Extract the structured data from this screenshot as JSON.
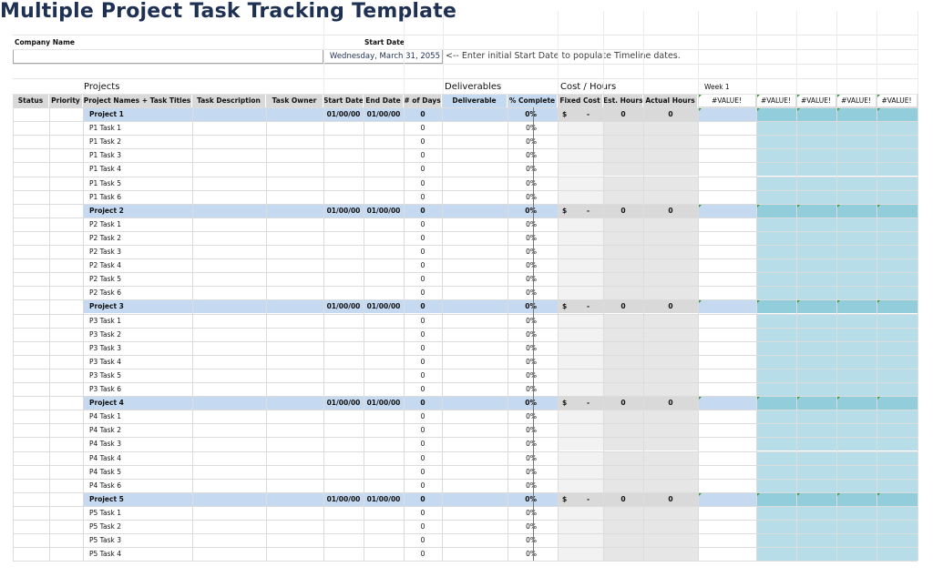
{
  "title": "Multiple Project Task Tracking Template",
  "company_name_label": "Company Name",
  "start_date_label": "Start Date",
  "start_date_value": "Wednesday, March 31, 2055",
  "start_date_hint": "<-- Enter initial Start Date to populate Timeline dates.",
  "sections": {
    "projects": "Projects",
    "deliverables": "Deliverables",
    "cost_hours": "Cost / Hours",
    "week": "Week 1"
  },
  "columns": {
    "status": "Status",
    "priority": "Priority",
    "names": "Project Names + Task Titles",
    "description": "Task Description",
    "owner": "Task Owner",
    "start": "Start Date",
    "end": "End Date",
    "days": "# of Days",
    "deliverable": "Deliverable",
    "complete": "% Complete",
    "fixed_cost": "Fixed Cost",
    "est_hours": "Est. Hours",
    "actual_hours": "Actual Hours",
    "timeline": [
      "#VALUE!",
      "#VALUE!",
      "#VALUE!",
      "#VALUE!",
      "#VALUE!"
    ]
  },
  "rows": [
    {
      "type": "project",
      "name": "Project 1",
      "start": "01/00/00",
      "end": "01/00/00",
      "days": "0",
      "complete": "0%",
      "cost": "$",
      "cost_val": "-",
      "est": "0",
      "actual": "0"
    },
    {
      "type": "task",
      "name": "P1 Task 1",
      "days": "0",
      "complete": "0%"
    },
    {
      "type": "task",
      "name": "P1 Task 2",
      "days": "0",
      "complete": "0%"
    },
    {
      "type": "task",
      "name": "P1 Task 3",
      "days": "0",
      "complete": "0%"
    },
    {
      "type": "task",
      "name": "P1 Task 4",
      "days": "0",
      "complete": "0%"
    },
    {
      "type": "task",
      "name": "P1 Task 5",
      "days": "0",
      "complete": "0%"
    },
    {
      "type": "task",
      "name": "P1 Task 6",
      "days": "0",
      "complete": "0%"
    },
    {
      "type": "project",
      "name": "Project 2",
      "start": "01/00/00",
      "end": "01/00/00",
      "days": "0",
      "complete": "0%",
      "cost": "$",
      "cost_val": "-",
      "est": "0",
      "actual": "0"
    },
    {
      "type": "task",
      "name": "P2 Task 1",
      "days": "0",
      "complete": "0%"
    },
    {
      "type": "task",
      "name": "P2 Task 2",
      "days": "0",
      "complete": "0%"
    },
    {
      "type": "task",
      "name": "P2 Task 3",
      "days": "0",
      "complete": "0%"
    },
    {
      "type": "task",
      "name": "P2 Task 4",
      "days": "0",
      "complete": "0%"
    },
    {
      "type": "task",
      "name": "P2 Task 5",
      "days": "0",
      "complete": "0%"
    },
    {
      "type": "task",
      "name": "P2 Task 6",
      "days": "0",
      "complete": "0%"
    },
    {
      "type": "project",
      "name": "Project 3",
      "start": "01/00/00",
      "end": "01/00/00",
      "days": "0",
      "complete": "0%",
      "cost": "$",
      "cost_val": "-",
      "est": "0",
      "actual": "0"
    },
    {
      "type": "task",
      "name": "P3 Task 1",
      "days": "0",
      "complete": "0%"
    },
    {
      "type": "task",
      "name": "P3 Task 2",
      "days": "0",
      "complete": "0%"
    },
    {
      "type": "task",
      "name": "P3 Task 3",
      "days": "0",
      "complete": "0%"
    },
    {
      "type": "task",
      "name": "P3 Task 4",
      "days": "0",
      "complete": "0%"
    },
    {
      "type": "task",
      "name": "P3 Task 5",
      "days": "0",
      "complete": "0%"
    },
    {
      "type": "task",
      "name": "P3 Task 6",
      "days": "0",
      "complete": "0%"
    },
    {
      "type": "project",
      "name": "Project 4",
      "start": "01/00/00",
      "end": "01/00/00",
      "days": "0",
      "complete": "0%",
      "cost": "$",
      "cost_val": "-",
      "est": "0",
      "actual": "0"
    },
    {
      "type": "task",
      "name": "P4 Task 1",
      "days": "0",
      "complete": "0%"
    },
    {
      "type": "task",
      "name": "P4 Task 2",
      "days": "0",
      "complete": "0%"
    },
    {
      "type": "task",
      "name": "P4 Task 3",
      "days": "0",
      "complete": "0%"
    },
    {
      "type": "task",
      "name": "P4 Task 4",
      "days": "0",
      "complete": "0%"
    },
    {
      "type": "task",
      "name": "P4 Task 5",
      "days": "0",
      "complete": "0%"
    },
    {
      "type": "task",
      "name": "P4 Task 6",
      "days": "0",
      "complete": "0%"
    },
    {
      "type": "project",
      "name": "Project 5",
      "start": "01/00/00",
      "end": "01/00/00",
      "days": "0",
      "complete": "0%",
      "cost": "$",
      "cost_val": "-",
      "est": "0",
      "actual": "0"
    },
    {
      "type": "task",
      "name": "P5 Task 1",
      "days": "0",
      "complete": "0%"
    },
    {
      "type": "task",
      "name": "P5 Task 2",
      "days": "0",
      "complete": "0%"
    },
    {
      "type": "task",
      "name": "P5 Task 3",
      "days": "0",
      "complete": "0%"
    },
    {
      "type": "task",
      "name": "P5 Task 4",
      "days": "0",
      "complete": "0%"
    }
  ],
  "colors": {
    "title": "#1f3153",
    "header_fill": "#d9d9d9",
    "project_fill": "#c5d9f1",
    "timeline_fill": "#b7dde8",
    "timeline_project_fill": "#92cddc",
    "cost_fill": "#f2f2f2",
    "hours_fill": "#e6e6e6"
  }
}
